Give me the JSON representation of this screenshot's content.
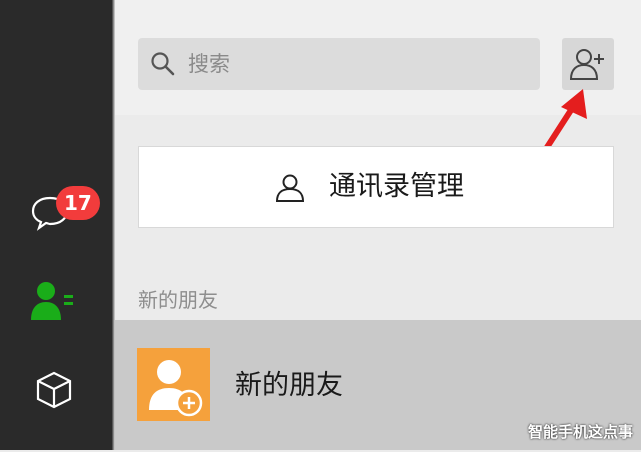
{
  "sidebar": {
    "chat_badge": "17",
    "icons": [
      "chat-icon",
      "contacts-icon",
      "mini-program-box-icon"
    ],
    "active_color": "#1aad19"
  },
  "search": {
    "placeholder": "搜索"
  },
  "header": {
    "add_contact_icon": "add-contact-icon"
  },
  "contacts_manage": {
    "label": "通讯录管理"
  },
  "new_friends_section": {
    "title": "新的朋友",
    "item_label": "新的朋友",
    "avatar_color": "#f5a13c"
  },
  "watermark": "智能手机这点事",
  "colors": {
    "badge": "#f23c3c",
    "arrow": "#e41e1e",
    "rail": "#2a2a2a"
  }
}
